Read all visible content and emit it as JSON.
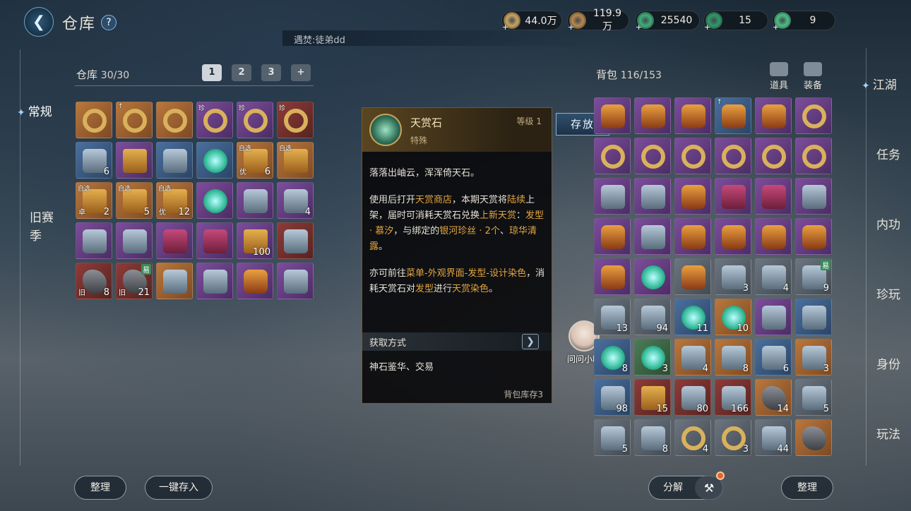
{
  "header": {
    "title": "仓库",
    "subtitle": "遇焚:徒弟dd"
  },
  "currencies": [
    {
      "name": "scroll-currency",
      "value": "44.0万",
      "color": "#c9a45f"
    },
    {
      "name": "coin-currency",
      "value": "119.9万",
      "color": "#b7894f"
    },
    {
      "name": "jade-currency",
      "value": "25540",
      "color": "#3fae7a"
    },
    {
      "name": "jade-token-currency",
      "value": "15",
      "color": "#2f9a6a"
    },
    {
      "name": "green-coin-currency",
      "value": "9",
      "color": "#4cbf86"
    }
  ],
  "left_nav": {
    "items": [
      {
        "label": "常规",
        "active": true
      },
      {
        "label": "旧赛",
        "active": false
      },
      {
        "label": "季",
        "active": false
      }
    ]
  },
  "warehouse": {
    "label": "仓库",
    "count": "30/30",
    "page_tabs": [
      "1",
      "2",
      "3"
    ],
    "slots": [
      {
        "quality": "orange",
        "art": "ring"
      },
      {
        "quality": "orange",
        "art": "ring",
        "tl": "↑"
      },
      {
        "quality": "orange",
        "art": "ring"
      },
      {
        "quality": "purple",
        "art": "ring",
        "tl": "珍"
      },
      {
        "quality": "purple",
        "art": "ring",
        "tl": "珍"
      },
      {
        "quality": "red",
        "art": "ring",
        "tl": "珍"
      },
      {
        "quality": "blue",
        "art": "misc",
        "count": "6"
      },
      {
        "quality": "purple",
        "art": "box"
      },
      {
        "quality": "blue",
        "art": "misc"
      },
      {
        "quality": "blue",
        "art": "gem"
      },
      {
        "quality": "orange",
        "art": "box",
        "tl": "自选",
        "bl": "优",
        "count": "6"
      },
      {
        "quality": "orange",
        "art": "box",
        "tl": "自选"
      },
      {
        "quality": "orange",
        "art": "box",
        "tl": "自选",
        "bl": "卓",
        "count": "2"
      },
      {
        "quality": "orange",
        "art": "box",
        "tl": "自选",
        "count": "5"
      },
      {
        "quality": "orange",
        "art": "box",
        "tl": "自选",
        "bl": "优",
        "count": "12"
      },
      {
        "quality": "purple",
        "art": "gem"
      },
      {
        "quality": "purple",
        "art": "misc"
      },
      {
        "quality": "purple",
        "art": "misc",
        "count": "4"
      },
      {
        "quality": "purple",
        "art": "misc"
      },
      {
        "quality": "purple",
        "art": "misc"
      },
      {
        "quality": "purple",
        "art": "cloth"
      },
      {
        "quality": "purple",
        "art": "cloth"
      },
      {
        "quality": "purple",
        "art": "box",
        "count": "100"
      },
      {
        "quality": "red",
        "art": "misc"
      },
      {
        "quality": "red",
        "art": "rock",
        "bl": "旧",
        "count": "8"
      },
      {
        "quality": "red",
        "art": "rock",
        "bl": "旧",
        "count": "21",
        "tr": "易"
      },
      {
        "quality": "orange",
        "art": "misc"
      },
      {
        "quality": "purple",
        "art": "misc"
      },
      {
        "quality": "purple",
        "art": "armor"
      },
      {
        "quality": "purple",
        "art": "misc"
      }
    ]
  },
  "tooltip": {
    "name": "天赏石",
    "level": "等级 1",
    "type": "特殊",
    "desc1": "落落出岫云，浑浑倚天石。",
    "desc2_parts": [
      {
        "text": "使用后打开",
        "hl": false
      },
      {
        "text": "天赏商店",
        "hl": true
      },
      {
        "text": "，本期天赏将",
        "hl": false
      },
      {
        "text": "陆续",
        "hl": true
      },
      {
        "text": "上架，届时可消耗天赏石兑换",
        "hl": false
      },
      {
        "text": "上新天赏",
        "hl": true
      },
      {
        "text": "：",
        "hl": false
      },
      {
        "text": "发型 · 慕汐",
        "hl": true
      },
      {
        "text": "，与绑定的",
        "hl": false
      },
      {
        "text": "银河珍丝 · 2个",
        "hl": true
      },
      {
        "text": "、",
        "hl": false
      },
      {
        "text": "琼华清露",
        "hl": true
      },
      {
        "text": "。",
        "hl": false
      }
    ],
    "desc3_parts": [
      {
        "text": "亦可前往",
        "hl": false
      },
      {
        "text": "菜单-外观界面-发型-设计染色",
        "hl": true
      },
      {
        "text": "，消耗天赏石对",
        "hl": false
      },
      {
        "text": "发型",
        "hl": true
      },
      {
        "text": "进行",
        "hl": false
      },
      {
        "text": "天赏染色",
        "hl": true
      },
      {
        "text": "。",
        "hl": false
      }
    ],
    "source_label": "获取方式",
    "source": "神石鉴华、交易",
    "stock": "背包库存3",
    "store_button": "存放"
  },
  "helper": {
    "label": "问问小暖"
  },
  "backpack": {
    "label": "背包",
    "count": "116/153",
    "categories": [
      "道具",
      "装备"
    ],
    "slots": [
      {
        "quality": "purple",
        "art": "armor"
      },
      {
        "quality": "purple",
        "art": "armor"
      },
      {
        "quality": "purple",
        "art": "armor"
      },
      {
        "quality": "blue",
        "art": "armor",
        "tl": "↑"
      },
      {
        "quality": "purple",
        "art": "armor"
      },
      {
        "quality": "purple",
        "art": "ring"
      },
      {
        "quality": "purple",
        "art": "ring"
      },
      {
        "quality": "purple",
        "art": "ring"
      },
      {
        "quality": "purple",
        "art": "ring"
      },
      {
        "quality": "purple",
        "art": "ring"
      },
      {
        "quality": "purple",
        "art": "ring"
      },
      {
        "quality": "purple",
        "art": "ring"
      },
      {
        "quality": "purple",
        "art": "misc"
      },
      {
        "quality": "purple",
        "art": "misc"
      },
      {
        "quality": "purple",
        "art": "armor"
      },
      {
        "quality": "purple",
        "art": "cloth"
      },
      {
        "quality": "purple",
        "art": "cloth"
      },
      {
        "quality": "purple",
        "art": "misc"
      },
      {
        "quality": "purple",
        "art": "armor"
      },
      {
        "quality": "purple",
        "art": "misc"
      },
      {
        "quality": "purple",
        "art": "armor"
      },
      {
        "quality": "purple",
        "art": "armor"
      },
      {
        "quality": "purple",
        "art": "armor"
      },
      {
        "quality": "purple",
        "art": "armor"
      },
      {
        "quality": "purple",
        "art": "armor"
      },
      {
        "quality": "purple",
        "art": "gem"
      },
      {
        "quality": "gray",
        "art": "armor"
      },
      {
        "quality": "gray",
        "art": "misc",
        "count": "3"
      },
      {
        "quality": "gray",
        "art": "misc",
        "count": "4"
      },
      {
        "quality": "gray",
        "art": "misc",
        "count": "9",
        "tr": "易"
      },
      {
        "quality": "gray",
        "art": "misc",
        "count": "13"
      },
      {
        "quality": "gray",
        "art": "misc",
        "count": "94"
      },
      {
        "quality": "blue",
        "art": "gem",
        "count": "11"
      },
      {
        "quality": "orange",
        "art": "gem",
        "count": "10"
      },
      {
        "quality": "purple",
        "art": "misc"
      },
      {
        "quality": "blue",
        "art": "misc"
      },
      {
        "quality": "blue",
        "art": "gem",
        "count": "8"
      },
      {
        "quality": "green",
        "art": "gem",
        "count": "3"
      },
      {
        "quality": "orange",
        "art": "misc",
        "count": "4"
      },
      {
        "quality": "orange",
        "art": "misc",
        "count": "8"
      },
      {
        "quality": "blue",
        "art": "misc",
        "count": "6"
      },
      {
        "quality": "orange",
        "art": "misc",
        "count": "3"
      },
      {
        "quality": "blue",
        "art": "misc",
        "count": "98"
      },
      {
        "quality": "red",
        "art": "box",
        "count": "15"
      },
      {
        "quality": "red",
        "art": "misc",
        "count": "80"
      },
      {
        "quality": "red",
        "art": "misc",
        "count": "166"
      },
      {
        "quality": "orange",
        "art": "rock",
        "count": "14"
      },
      {
        "quality": "gray",
        "art": "misc",
        "count": "5"
      },
      {
        "quality": "gray",
        "art": "misc",
        "count": "5"
      },
      {
        "quality": "gray",
        "art": "misc",
        "count": "8"
      },
      {
        "quality": "gray",
        "art": "ring",
        "count": "4"
      },
      {
        "quality": "gray",
        "art": "ring",
        "count": "3"
      },
      {
        "quality": "gray",
        "art": "misc",
        "count": "44"
      },
      {
        "quality": "orange",
        "art": "rock"
      }
    ]
  },
  "right_nav": {
    "items": [
      {
        "label": "江湖",
        "active": true
      },
      {
        "label": "任务",
        "active": false
      },
      {
        "label": "内功",
        "active": false
      },
      {
        "label": "珍玩",
        "active": false
      },
      {
        "label": "身份",
        "active": false
      },
      {
        "label": "玩法",
        "active": false
      }
    ]
  },
  "footer": {
    "sort_left": "整理",
    "deposit_all": "一键存入",
    "decompose": "分解",
    "sort_right": "整理"
  }
}
